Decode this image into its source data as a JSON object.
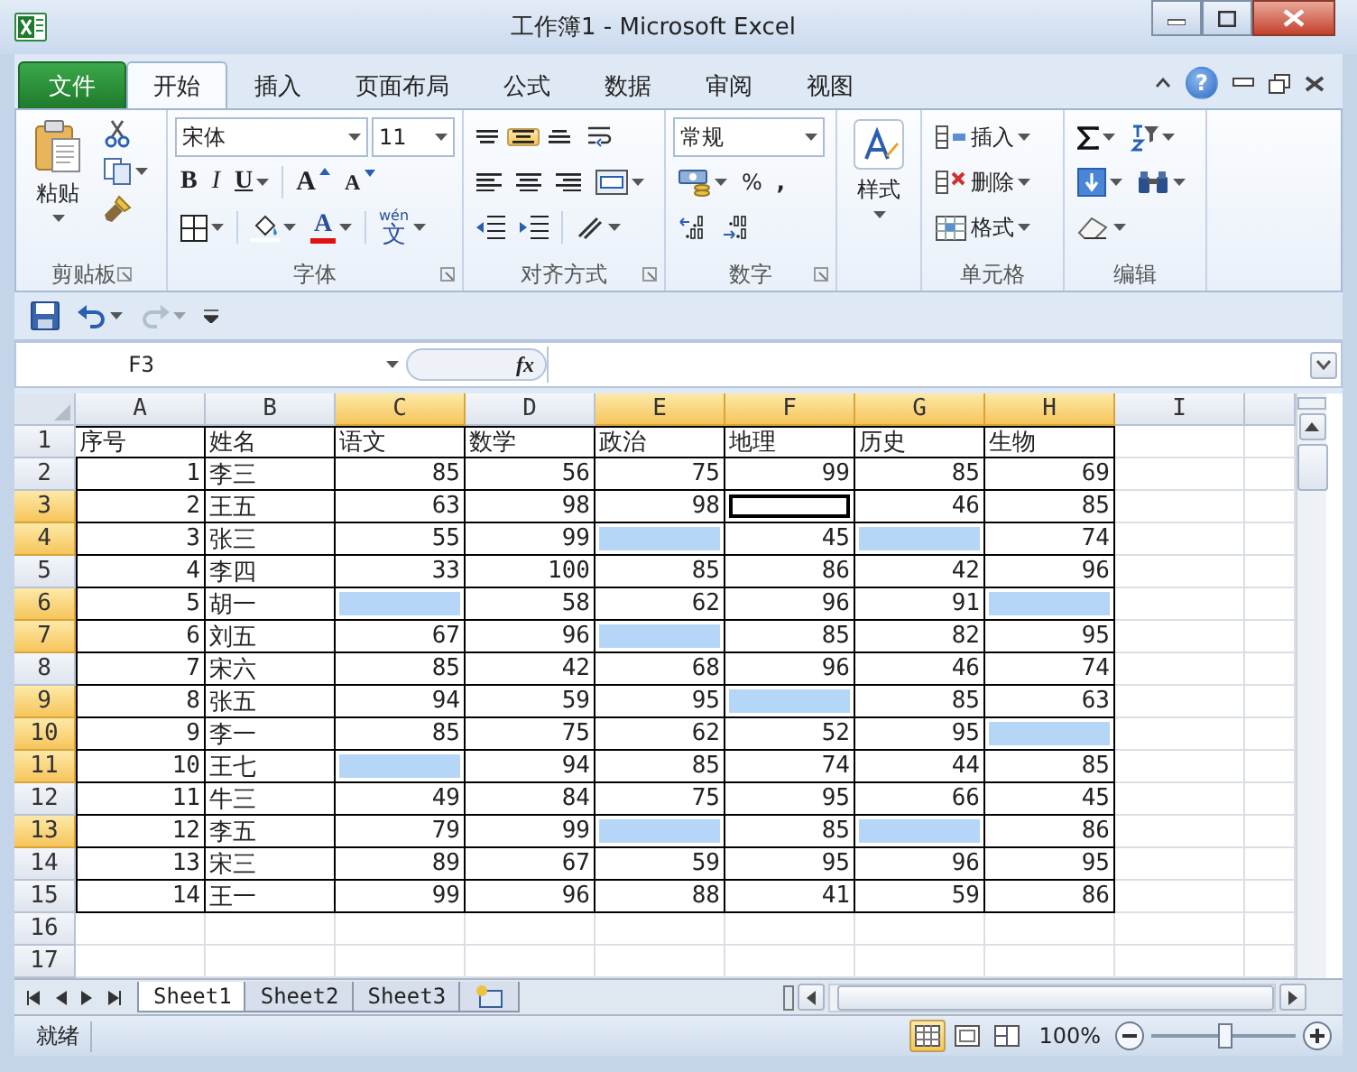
{
  "window": {
    "title": "工作簿1 - Microsoft Excel",
    "help": "?"
  },
  "ribbon_tabs": [
    {
      "label": "文件",
      "kind": "file",
      "selected": false
    },
    {
      "label": "开始",
      "kind": "tab",
      "selected": true
    },
    {
      "label": "插入",
      "kind": "tab",
      "selected": false
    },
    {
      "label": "页面布局",
      "kind": "tab",
      "selected": false
    },
    {
      "label": "公式",
      "kind": "tab",
      "selected": false
    },
    {
      "label": "数据",
      "kind": "tab",
      "selected": false
    },
    {
      "label": "审阅",
      "kind": "tab",
      "selected": false
    },
    {
      "label": "视图",
      "kind": "tab",
      "selected": false
    }
  ],
  "ribbon": {
    "clipboard": {
      "paste": "粘贴",
      "label": "剪贴板"
    },
    "font": {
      "name": "宋体",
      "size": "11",
      "bold": "B",
      "italic": "I",
      "underline": "U",
      "grow": "A",
      "shrink": "A",
      "color_letter": "A",
      "phonetic_ruby": "wén",
      "phonetic_base": "文",
      "label": "字体"
    },
    "alignment": {
      "vertical": [
        {
          "kind": "top",
          "selected": false
        },
        {
          "kind": "middle",
          "selected": true
        },
        {
          "kind": "bottom",
          "selected": false
        }
      ],
      "label": "对齐方式"
    },
    "number": {
      "format": "常规",
      "percent": "%",
      "comma": ",",
      "label": "数字"
    },
    "styles": {
      "button": "样式"
    },
    "cells": {
      "buttons": [
        {
          "label": "插入",
          "kind": "insert"
        },
        {
          "label": "删除",
          "kind": "delete"
        },
        {
          "label": "格式",
          "kind": "format"
        }
      ],
      "label": "单元格"
    },
    "editing": {
      "label": "编辑"
    }
  },
  "formula_bar": {
    "name_box": "F3",
    "fx": "fx"
  },
  "sheet": {
    "columns": [
      {
        "label": "A",
        "selected": false
      },
      {
        "label": "B",
        "selected": false
      },
      {
        "label": "C",
        "selected": true
      },
      {
        "label": "D",
        "selected": false
      },
      {
        "label": "E",
        "selected": true
      },
      {
        "label": "F",
        "selected": true
      },
      {
        "label": "G",
        "selected": true
      },
      {
        "label": "H",
        "selected": true
      },
      {
        "label": "I",
        "selected": false
      }
    ],
    "rows": [
      {
        "header": "1",
        "selected": false,
        "cells": [
          "序号",
          "姓名",
          "语文",
          "数学",
          "政治",
          "地理",
          "历史",
          "生物"
        ]
      },
      {
        "header": "2",
        "selected": false,
        "cells": [
          "1",
          "李三",
          "85",
          "56",
          "75",
          "99",
          "85",
          "69"
        ]
      },
      {
        "header": "3",
        "selected": true,
        "cells": [
          "2",
          "王五",
          "63",
          "98",
          "98",
          {
            "active": true
          },
          "46",
          "85"
        ]
      },
      {
        "header": "4",
        "selected": true,
        "cells": [
          "3",
          "张三",
          "55",
          "99",
          {
            "selected": true
          },
          "45",
          {
            "selected": true
          },
          "74"
        ]
      },
      {
        "header": "5",
        "selected": false,
        "cells": [
          "4",
          "李四",
          "33",
          "100",
          "85",
          "86",
          "42",
          "96"
        ]
      },
      {
        "header": "6",
        "selected": true,
        "cells": [
          "5",
          "胡一",
          {
            "selected": true
          },
          "58",
          "62",
          "96",
          "91",
          {
            "selected": true
          }
        ]
      },
      {
        "header": "7",
        "selected": true,
        "cells": [
          "6",
          "刘五",
          "67",
          "96",
          {
            "selected": true
          },
          "85",
          "82",
          "95"
        ]
      },
      {
        "header": "8",
        "selected": false,
        "cells": [
          "7",
          "宋六",
          "85",
          "42",
          "68",
          "96",
          "46",
          "74"
        ]
      },
      {
        "header": "9",
        "selected": true,
        "cells": [
          "8",
          "张五",
          "94",
          "59",
          "95",
          {
            "selected": true
          },
          "85",
          "63"
        ]
      },
      {
        "header": "10",
        "selected": true,
        "cells": [
          "9",
          "李一",
          "85",
          "75",
          "62",
          "52",
          "95",
          {
            "selected": true
          }
        ]
      },
      {
        "header": "11",
        "selected": true,
        "cells": [
          "10",
          "王七",
          {
            "selected": true
          },
          "94",
          "85",
          "74",
          "44",
          "85"
        ]
      },
      {
        "header": "12",
        "selected": false,
        "cells": [
          "11",
          "牛三",
          "49",
          "84",
          "75",
          "95",
          "66",
          "45"
        ]
      },
      {
        "header": "13",
        "selected": true,
        "cells": [
          "12",
          "李五",
          "79",
          "99",
          {
            "selected": true
          },
          "85",
          {
            "selected": true
          },
          "86"
        ]
      },
      {
        "header": "14",
        "selected": false,
        "cells": [
          "13",
          "宋三",
          "89",
          "67",
          "59",
          "95",
          "96",
          "95"
        ]
      },
      {
        "header": "15",
        "selected": false,
        "cells": [
          "14",
          "王一",
          "99",
          "96",
          "88",
          "41",
          "59",
          "86"
        ]
      },
      {
        "header": "16",
        "selected": false
      },
      {
        "header": "17",
        "selected": false
      }
    ]
  },
  "sheet_tabs": [
    {
      "label": "Sheet1",
      "selected": true
    },
    {
      "label": "Sheet2",
      "selected": false
    },
    {
      "label": "Sheet3",
      "selected": false
    }
  ],
  "status_bar": {
    "text": "就绪",
    "views": [
      {
        "kind": "normal",
        "selected": true
      },
      {
        "kind": "layout",
        "selected": false
      },
      {
        "kind": "break",
        "selected": false
      }
    ],
    "zoom": "100%"
  }
}
